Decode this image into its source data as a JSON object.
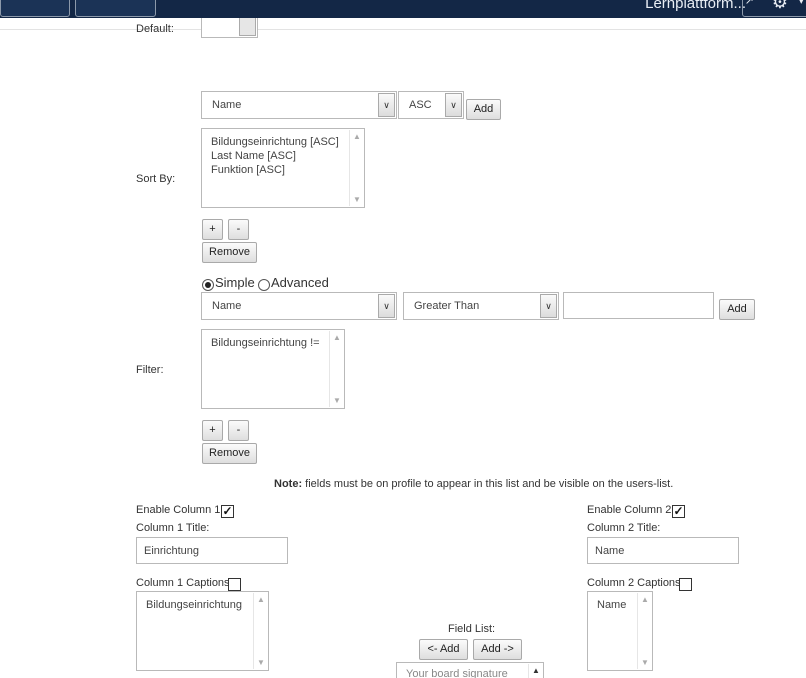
{
  "topbar": {
    "title": "Lernplattform...",
    "ext_icon": "external-link-icon",
    "gear_icon": "gear-icon",
    "caret_icon": "caret-down-icon"
  },
  "default": {
    "label": "Default:"
  },
  "sort": {
    "label": "Sort By:",
    "field_select": "Name",
    "order_select": "ASC",
    "add_label": "Add",
    "items": [
      "Bildungseinrichtung [ASC]",
      "Last Name [ASC]",
      "Funktion [ASC]"
    ],
    "plus_label": "+",
    "minus_label": "-",
    "remove_label": "Remove"
  },
  "filter": {
    "label": "Filter:",
    "mode_simple": "Simple",
    "mode_advanced": "Advanced",
    "selected_mode": "Simple",
    "field_select": "Name",
    "operator_select": "Greater Than",
    "value": "",
    "add_label": "Add",
    "items": [
      "Bildungseinrichtung !="
    ],
    "plus_label": "+",
    "minus_label": "-",
    "remove_label": "Remove"
  },
  "note": {
    "bold": "Note:",
    "text": " fields must be on profile to appear in this list and be visible on the users-list."
  },
  "column1": {
    "enable_label": "Enable Column 1:",
    "enabled": true,
    "title_label": "Column 1 Title:",
    "title_value": "Einrichtung",
    "captions_label": "Column 1 Captions:",
    "captions_checked": false,
    "items": [
      "Bildungseinrichtung"
    ]
  },
  "column2": {
    "enable_label": "Enable Column 2:",
    "enabled": true,
    "title_label": "Column 2 Title:",
    "title_value": "Name",
    "captions_label": "Column 2 Captions:",
    "captions_checked": false,
    "items": [
      "Name"
    ]
  },
  "field_list": {
    "label": "Field List:",
    "move_left_label": "<- Add",
    "move_right_label": "Add ->",
    "first_item": "Your board signature"
  }
}
